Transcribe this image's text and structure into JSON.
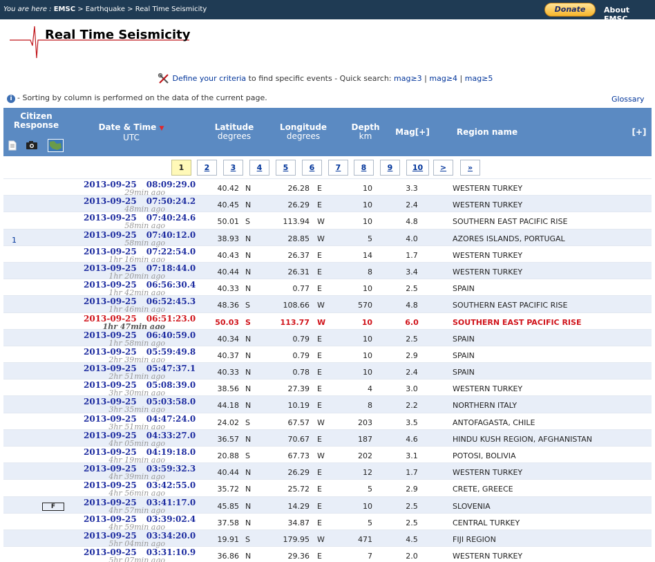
{
  "topbar": {
    "you_are_here": "You are here :",
    "crumb_root": "EMSC",
    "crumb_trail": " > Earthquake > Real Time Seismicity",
    "donate_label": "Donate",
    "about_label": "About EMSC"
  },
  "logo": {
    "title": "Real Time Seismicity"
  },
  "criteria": {
    "define_link": "Define your criteria",
    "text": " to find specific events - Quick search: ",
    "quick": [
      "mag≥3",
      "mag≥4",
      "mag≥5"
    ],
    "sep": " | "
  },
  "sortnote": {
    "text": "- Sorting by column is performed on the data of the current page."
  },
  "glossary_label": "Glossary",
  "header": {
    "citizen": "Citizen",
    "response": "Response",
    "datetime": "Date & Time",
    "utc": "UTC",
    "latitude": "Latitude",
    "lat_unit": "degrees",
    "longitude": "Longitude",
    "lon_unit": "degrees",
    "depth": "Depth",
    "depth_unit": "km",
    "mag": "Mag[+]",
    "region": "Region name",
    "expand": "[+]",
    "sort_arrow": "▼"
  },
  "pager": {
    "pages": [
      "1",
      "2",
      "3",
      "4",
      "5",
      "6",
      "7",
      "8",
      "9",
      "10",
      ">",
      "»"
    ],
    "current": "1"
  },
  "events": [
    {
      "cit": "",
      "date": "2013-09-25",
      "time": "08:09:29.0",
      "ago": "29min ago",
      "lat": "40.42",
      "ns": "N",
      "lon": "26.28",
      "ew": "E",
      "depth": "10",
      "mag": "3.3",
      "region": "WESTERN TURKEY"
    },
    {
      "cit": "",
      "date": "2013-09-25",
      "time": "07:50:24.2",
      "ago": "48min ago",
      "lat": "40.45",
      "ns": "N",
      "lon": "26.29",
      "ew": "E",
      "depth": "10",
      "mag": "2.4",
      "region": "WESTERN TURKEY"
    },
    {
      "cit": "",
      "date": "2013-09-25",
      "time": "07:40:24.6",
      "ago": "58min ago",
      "lat": "50.01",
      "ns": "S",
      "lon": "113.94",
      "ew": "W",
      "depth": "10",
      "mag": "4.8",
      "region": "SOUTHERN EAST PACIFIC RISE"
    },
    {
      "cit": "1",
      "date": "2013-09-25",
      "time": "07:40:12.0",
      "ago": "58min ago",
      "lat": "38.93",
      "ns": "N",
      "lon": "28.85",
      "ew": "W",
      "depth": "5",
      "mag": "4.0",
      "region": "AZORES ISLANDS, PORTUGAL"
    },
    {
      "cit": "",
      "date": "2013-09-25",
      "time": "07:22:54.0",
      "ago": "1hr 16min ago",
      "lat": "40.43",
      "ns": "N",
      "lon": "26.37",
      "ew": "E",
      "depth": "14",
      "mag": "1.7",
      "region": "WESTERN TURKEY"
    },
    {
      "cit": "",
      "date": "2013-09-25",
      "time": "07:18:44.0",
      "ago": "1hr 20min ago",
      "lat": "40.44",
      "ns": "N",
      "lon": "26.31",
      "ew": "E",
      "depth": "8",
      "mag": "3.4",
      "region": "WESTERN TURKEY"
    },
    {
      "cit": "",
      "date": "2013-09-25",
      "time": "06:56:30.4",
      "ago": "1hr 42min ago",
      "lat": "40.33",
      "ns": "N",
      "lon": "0.77",
      "ew": "E",
      "depth": "10",
      "mag": "2.5",
      "region": "SPAIN"
    },
    {
      "cit": "",
      "date": "2013-09-25",
      "time": "06:52:45.3",
      "ago": "1hr 46min ago",
      "lat": "48.36",
      "ns": "S",
      "lon": "108.66",
      "ew": "W",
      "depth": "570",
      "mag": "4.8",
      "region": "SOUTHERN EAST PACIFIC RISE"
    },
    {
      "cit": "",
      "date": "2013-09-25",
      "time": "06:51:23.0",
      "ago": "1hr 47min ago",
      "lat": "50.03",
      "ns": "S",
      "lon": "113.77",
      "ew": "W",
      "depth": "10",
      "mag": "6.0",
      "region": "SOUTHERN EAST PACIFIC RISE",
      "highlight": true
    },
    {
      "cit": "",
      "date": "2013-09-25",
      "time": "06:40:59.0",
      "ago": "1hr 58min ago",
      "lat": "40.34",
      "ns": "N",
      "lon": "0.79",
      "ew": "E",
      "depth": "10",
      "mag": "2.5",
      "region": "SPAIN"
    },
    {
      "cit": "",
      "date": "2013-09-25",
      "time": "05:59:49.8",
      "ago": "2hr 39min ago",
      "lat": "40.37",
      "ns": "N",
      "lon": "0.79",
      "ew": "E",
      "depth": "10",
      "mag": "2.9",
      "region": "SPAIN"
    },
    {
      "cit": "",
      "date": "2013-09-25",
      "time": "05:47:37.1",
      "ago": "2hr 51min ago",
      "lat": "40.33",
      "ns": "N",
      "lon": "0.78",
      "ew": "E",
      "depth": "10",
      "mag": "2.4",
      "region": "SPAIN"
    },
    {
      "cit": "",
      "date": "2013-09-25",
      "time": "05:08:39.0",
      "ago": "3hr 30min ago",
      "lat": "38.56",
      "ns": "N",
      "lon": "27.39",
      "ew": "E",
      "depth": "4",
      "mag": "3.0",
      "region": "WESTERN TURKEY"
    },
    {
      "cit": "",
      "date": "2013-09-25",
      "time": "05:03:58.0",
      "ago": "3hr 35min ago",
      "lat": "44.18",
      "ns": "N",
      "lon": "10.19",
      "ew": "E",
      "depth": "8",
      "mag": "2.2",
      "region": "NORTHERN ITALY"
    },
    {
      "cit": "",
      "date": "2013-09-25",
      "time": "04:47:24.0",
      "ago": "3hr 51min ago",
      "lat": "24.02",
      "ns": "S",
      "lon": "67.57",
      "ew": "W",
      "depth": "203",
      "mag": "3.5",
      "region": "ANTOFAGASTA, CHILE"
    },
    {
      "cit": "",
      "date": "2013-09-25",
      "time": "04:33:27.0",
      "ago": "4hr 05min ago",
      "lat": "36.57",
      "ns": "N",
      "lon": "70.67",
      "ew": "E",
      "depth": "187",
      "mag": "4.6",
      "region": "HINDU KUSH REGION, AFGHANISTAN"
    },
    {
      "cit": "",
      "date": "2013-09-25",
      "time": "04:19:18.0",
      "ago": "4hr 19min ago",
      "lat": "20.88",
      "ns": "S",
      "lon": "67.73",
      "ew": "W",
      "depth": "202",
      "mag": "3.1",
      "region": "POTOSI, BOLIVIA"
    },
    {
      "cit": "",
      "date": "2013-09-25",
      "time": "03:59:32.3",
      "ago": "4hr 39min ago",
      "lat": "40.44",
      "ns": "N",
      "lon": "26.29",
      "ew": "E",
      "depth": "12",
      "mag": "1.7",
      "region": "WESTERN TURKEY"
    },
    {
      "cit": "",
      "date": "2013-09-25",
      "time": "03:42:55.0",
      "ago": "4hr 56min ago",
      "lat": "35.72",
      "ns": "N",
      "lon": "25.72",
      "ew": "E",
      "depth": "5",
      "mag": "2.9",
      "region": "CRETE, GREECE"
    },
    {
      "cit": "F",
      "date": "2013-09-25",
      "time": "03:41:17.0",
      "ago": "4hr 57min ago",
      "lat": "45.85",
      "ns": "N",
      "lon": "14.29",
      "ew": "E",
      "depth": "10",
      "mag": "2.5",
      "region": "SLOVENIA"
    },
    {
      "cit": "",
      "date": "2013-09-25",
      "time": "03:39:02.4",
      "ago": "4hr 59min ago",
      "lat": "37.58",
      "ns": "N",
      "lon": "34.87",
      "ew": "E",
      "depth": "5",
      "mag": "2.5",
      "region": "CENTRAL TURKEY"
    },
    {
      "cit": "",
      "date": "2013-09-25",
      "time": "03:34:20.0",
      "ago": "5hr 04min ago",
      "lat": "19.91",
      "ns": "S",
      "lon": "179.95",
      "ew": "W",
      "depth": "471",
      "mag": "4.5",
      "region": "FIJI REGION"
    },
    {
      "cit": "",
      "date": "2013-09-25",
      "time": "03:31:10.9",
      "ago": "5hr 07min ago",
      "lat": "36.86",
      "ns": "N",
      "lon": "29.36",
      "ew": "E",
      "depth": "7",
      "mag": "2.0",
      "region": "WESTERN TURKEY"
    }
  ]
}
